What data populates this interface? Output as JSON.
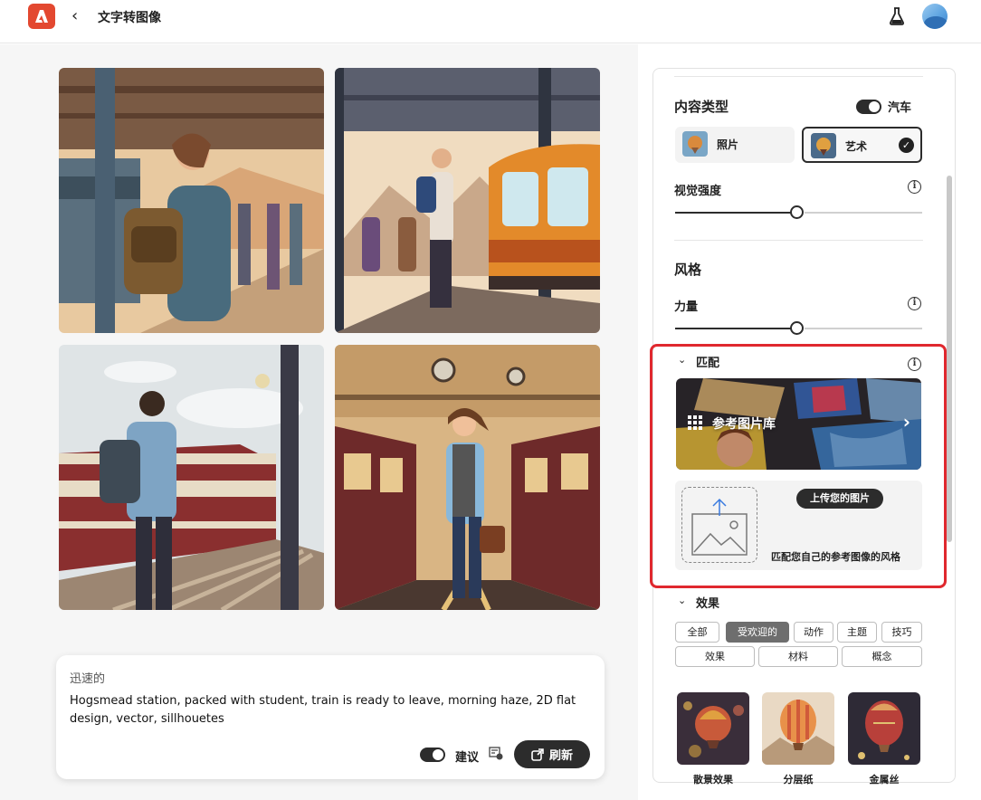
{
  "header": {
    "title": "文字转图像",
    "back_icon": "chevron-left-icon",
    "logo_icon": "adobe-firefly-logo",
    "labs_icon": "flask-icon"
  },
  "images": [
    {
      "name": "generated-image-1"
    },
    {
      "name": "generated-image-2"
    },
    {
      "name": "generated-image-3"
    },
    {
      "name": "generated-image-4"
    }
  ],
  "prompt": {
    "label": "迅速的",
    "text": "Hogsmead station, packed with student, train is ready to leave, morning haze, 2D flat design, vector, sillhouetes",
    "suggest_label": "建议",
    "refresh_label": "刷新"
  },
  "panel": {
    "content_type": {
      "title": "内容类型",
      "toggle_label": "汽车",
      "options": [
        {
          "label": "照片",
          "selected": false
        },
        {
          "label": "艺术",
          "selected": true
        }
      ]
    },
    "visual_intensity": {
      "label": "视觉强度",
      "value": 0.5
    },
    "style": {
      "title": "风格",
      "strength_label": "力量",
      "strength_value": 0.5
    },
    "match": {
      "title": "匹配",
      "gallery_label": "参考图片库",
      "upload_button": "上传您的图片",
      "upload_caption": "匹配您自己的参考图像的风格"
    },
    "effects": {
      "title": "效果",
      "chips_row1": [
        "全部",
        "受欢迎的",
        "动作",
        "主题",
        "技巧"
      ],
      "chips_row2": [
        "效果",
        "材料",
        "概念"
      ],
      "active_chip": "受欢迎的",
      "thumbnails": [
        "散景效果",
        "分层纸",
        "金属丝"
      ]
    }
  },
  "colors": {
    "accent_dark": "#2c2c2c",
    "highlight_red": "#e0282e",
    "logo_red": "#e34830"
  }
}
